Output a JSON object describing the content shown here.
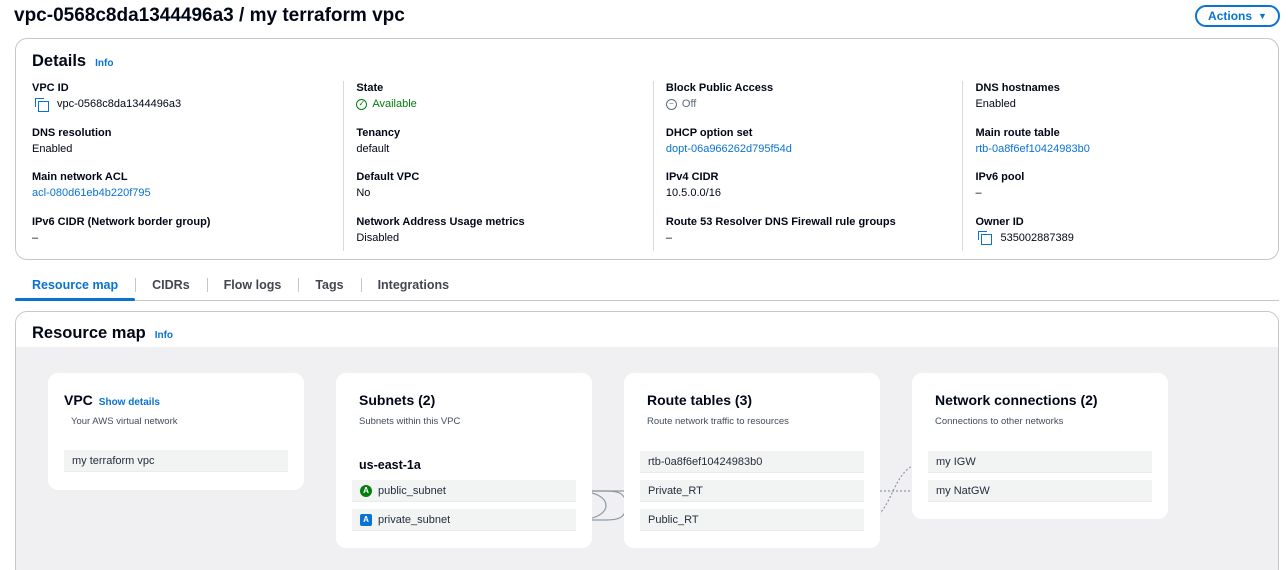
{
  "header": {
    "title": "vpc-0568c8da1344496a3 / my terraform vpc",
    "actions_label": "Actions"
  },
  "details": {
    "title": "Details",
    "info": "Info",
    "columns": [
      [
        {
          "label": "VPC ID",
          "value": "vpc-0568c8da1344496a3"
        },
        {
          "label": "DNS resolution",
          "value": "Enabled"
        },
        {
          "label": "Main network ACL",
          "value": "acl-080d61eb4b220f795"
        },
        {
          "label": "IPv6 CIDR (Network border group)",
          "value": "–"
        }
      ],
      [
        {
          "label": "State",
          "value": "Available"
        },
        {
          "label": "Tenancy",
          "value": "default"
        },
        {
          "label": "Default VPC",
          "value": "No"
        },
        {
          "label": "Network Address Usage metrics",
          "value": "Disabled"
        }
      ],
      [
        {
          "label": "Block Public Access",
          "value": "Off"
        },
        {
          "label": "DHCP option set",
          "value": "dopt-06a966262d795f54d"
        },
        {
          "label": "IPv4 CIDR",
          "value": "10.5.0.0/16"
        },
        {
          "label": "Route 53 Resolver DNS Firewall rule groups",
          "value": "–"
        }
      ],
      [
        {
          "label": "DNS hostnames",
          "value": "Enabled"
        },
        {
          "label": "Main route table",
          "value": "rtb-0a8f6ef10424983b0"
        },
        {
          "label": "IPv6 pool",
          "value": "–"
        },
        {
          "label": "Owner ID",
          "value": "535002887389"
        }
      ]
    ]
  },
  "tabs": [
    "Resource map",
    "CIDRs",
    "Flow logs",
    "Tags",
    "Integrations"
  ],
  "resource_map": {
    "title": "Resource map",
    "info": "Info",
    "vpc": {
      "title": "VPC",
      "show_details": "Show details",
      "subtitle": "Your AWS virtual network",
      "name": "my terraform vpc"
    },
    "subnets": {
      "title": "Subnets (2)",
      "subtitle": "Subnets within this VPC",
      "region": "us-east-1a",
      "items": [
        {
          "badge": "A",
          "name": "public_subnet"
        },
        {
          "badge": "A",
          "name": "private_subnet"
        }
      ]
    },
    "route_tables": {
      "title": "Route tables (3)",
      "subtitle": "Route network traffic to resources",
      "items": [
        "rtb-0a8f6ef10424983b0",
        "Private_RT",
        "Public_RT"
      ]
    },
    "network_connections": {
      "title": "Network connections (2)",
      "subtitle": "Connections to other networks",
      "items": [
        "my IGW",
        "my NatGW"
      ]
    }
  },
  "colors": {
    "accent": "#0972d3",
    "success": "#037f0c"
  }
}
